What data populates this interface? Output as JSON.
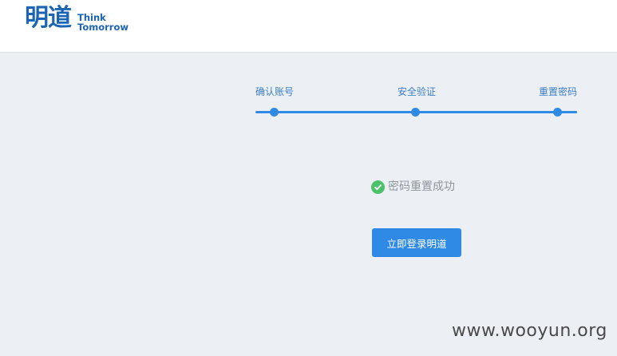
{
  "header": {
    "logo_cn": "明道",
    "logo_en_line1": "Think",
    "logo_en_line2": "Tomorrow"
  },
  "steps": {
    "items": [
      {
        "label": "确认账号"
      },
      {
        "label": "安全验证"
      },
      {
        "label": "重置密码"
      }
    ],
    "completed": 3,
    "total": 3
  },
  "result": {
    "message": "密码重置成功",
    "icon": "check-circle-icon"
  },
  "actions": {
    "login_label": "立即登录明道"
  },
  "watermark": "www.wooyun.org",
  "colors": {
    "brand": "#1c64b4",
    "accent": "#2f8ae5",
    "success": "#4cc26a",
    "background": "#eceff4"
  }
}
